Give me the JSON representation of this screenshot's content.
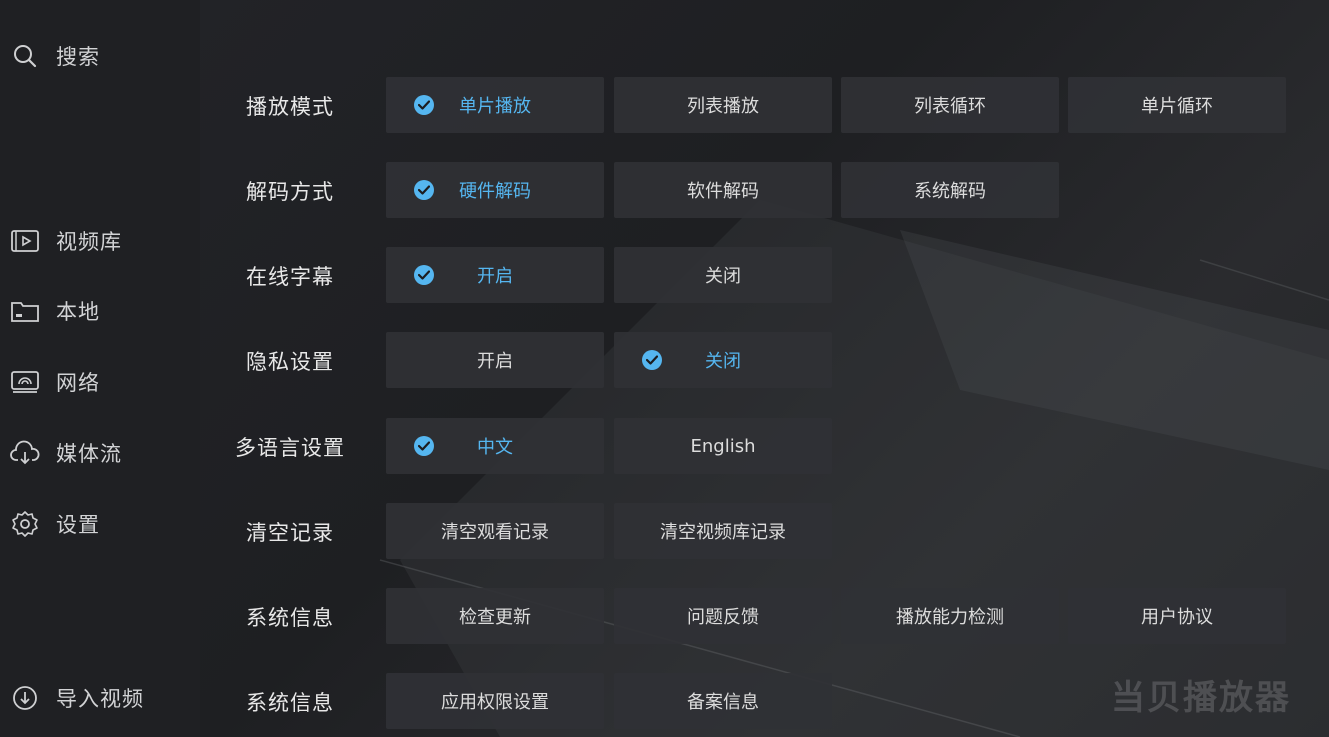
{
  "sidebar": {
    "search": {
      "label": "搜索",
      "icon": "search-icon"
    },
    "items": [
      {
        "label": "视频库",
        "icon": "video-library-icon"
      },
      {
        "label": "本地",
        "icon": "folder-icon"
      },
      {
        "label": "网络",
        "icon": "network-icon"
      },
      {
        "label": "媒体流",
        "icon": "cloud-icon"
      },
      {
        "label": "设置",
        "icon": "gear-icon"
      }
    ],
    "import": {
      "label": "导入视频",
      "icon": "import-icon"
    }
  },
  "settings": {
    "rows": [
      {
        "label": "播放模式",
        "options": [
          {
            "label": "单片播放",
            "selected": true
          },
          {
            "label": "列表播放",
            "selected": false
          },
          {
            "label": "列表循环",
            "selected": false
          },
          {
            "label": "单片循环",
            "selected": false
          }
        ]
      },
      {
        "label": "解码方式",
        "options": [
          {
            "label": "硬件解码",
            "selected": true
          },
          {
            "label": "软件解码",
            "selected": false
          },
          {
            "label": "系统解码",
            "selected": false
          }
        ]
      },
      {
        "label": "在线字幕",
        "options": [
          {
            "label": "开启",
            "selected": true
          },
          {
            "label": "关闭",
            "selected": false
          }
        ]
      },
      {
        "label": "隐私设置",
        "options": [
          {
            "label": "开启",
            "selected": false
          },
          {
            "label": "关闭",
            "selected": true
          }
        ]
      },
      {
        "label": "多语言设置",
        "options": [
          {
            "label": "中文",
            "selected": true
          },
          {
            "label": "English",
            "selected": false
          }
        ]
      },
      {
        "label": "清空记录",
        "options": [
          {
            "label": "清空观看记录",
            "selected": false
          },
          {
            "label": "清空视频库记录",
            "selected": false
          }
        ]
      },
      {
        "label": "系统信息",
        "options": [
          {
            "label": "检查更新",
            "selected": false
          },
          {
            "label": "问题反馈",
            "selected": false
          },
          {
            "label": "播放能力检测",
            "selected": false
          },
          {
            "label": "用户协议",
            "selected": false
          }
        ]
      },
      {
        "label": "系统信息",
        "options": [
          {
            "label": "应用权限设置",
            "selected": false
          },
          {
            "label": "备案信息",
            "selected": false
          }
        ]
      }
    ]
  },
  "watermark": "当贝播放器",
  "colors": {
    "accent": "#55b6f0",
    "option_bg": "#303135",
    "sidebar_bg": "#1f2023"
  }
}
